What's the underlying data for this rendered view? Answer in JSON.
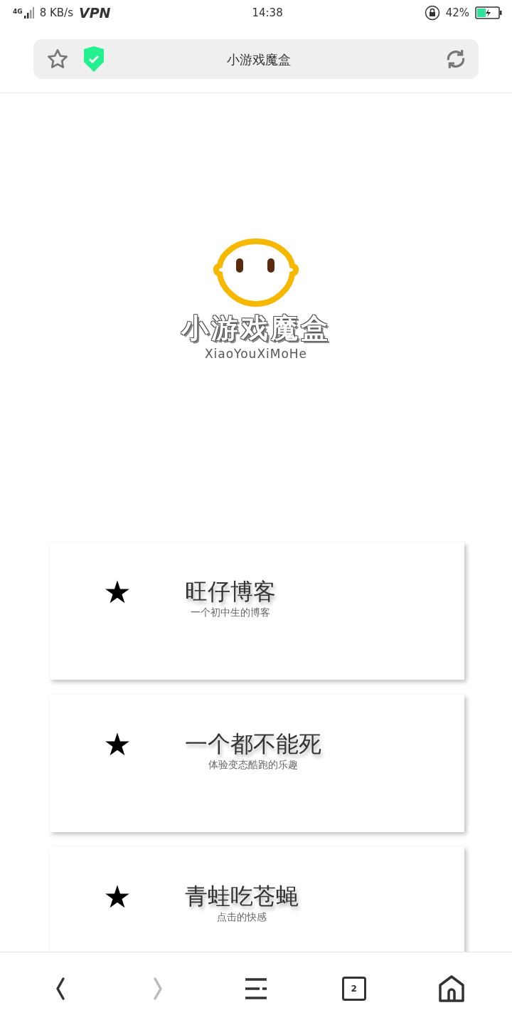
{
  "status_bar": {
    "network": "4G",
    "speed": "8 KB/s",
    "vpn": "VPN",
    "time": "14:38",
    "battery": "42%"
  },
  "address_bar": {
    "title": "小游戏魔盒",
    "secure": true
  },
  "logo": {
    "title": "小游戏魔盒",
    "subtitle": "XiaoYouXiMoHe"
  },
  "cards": [
    {
      "star": "★",
      "title": "旺仔博客",
      "subtitle": "一个初中生的博客"
    },
    {
      "star": "★",
      "title": "一个都不能死",
      "subtitle": "体验变态酷跑的乐趣"
    },
    {
      "star": "★",
      "title": "青蛙吃苍蝇",
      "subtitle": "点击的快感"
    }
  ],
  "bottom_nav": [
    {
      "kind": "back",
      "disabled": false
    },
    {
      "kind": "forward",
      "disabled": true
    },
    {
      "kind": "menu",
      "disabled": false
    },
    {
      "kind": "tabs",
      "count": "2",
      "disabled": false
    },
    {
      "kind": "home",
      "disabled": false
    }
  ]
}
